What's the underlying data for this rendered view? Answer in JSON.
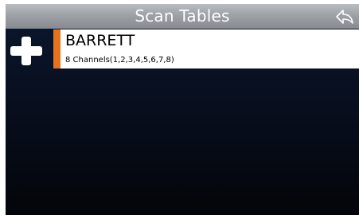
{
  "header": {
    "title": "Scan Tables",
    "back_icon": "back-arrow-icon"
  },
  "toolbar": {
    "add_icon": "plus-icon"
  },
  "scan_tables": [
    {
      "name": "BARRETT",
      "details": "8 Channels(1,2,3,4,5,6,7,8)",
      "accent_color": "#e8711c"
    }
  ]
}
